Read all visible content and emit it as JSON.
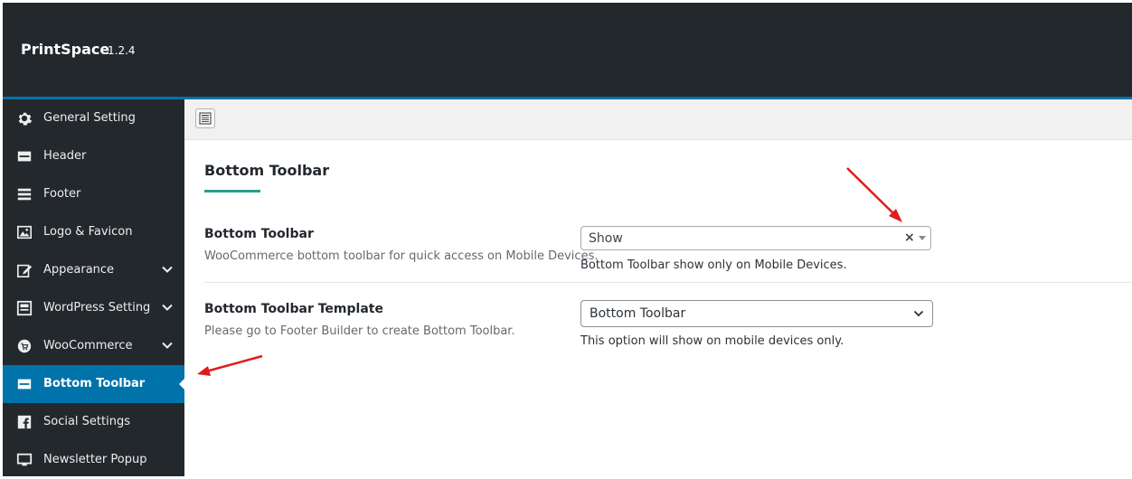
{
  "app": {
    "name": "PrintSpace",
    "version": "1.2.4"
  },
  "sidebar": {
    "items": [
      {
        "label": "General Setting",
        "icon": "gear-icon",
        "has_chevron": false,
        "active": false
      },
      {
        "label": "Header",
        "icon": "header-icon",
        "has_chevron": false,
        "active": false
      },
      {
        "label": "Footer",
        "icon": "menu-lines-icon",
        "has_chevron": false,
        "active": false
      },
      {
        "label": "Logo & Favicon",
        "icon": "image-icon",
        "has_chevron": false,
        "active": false
      },
      {
        "label": "Appearance",
        "icon": "edit-icon",
        "has_chevron": true,
        "active": false
      },
      {
        "label": "WordPress Setting",
        "icon": "layout-icon",
        "has_chevron": true,
        "active": false
      },
      {
        "label": "WooCommerce",
        "icon": "cart-icon",
        "has_chevron": true,
        "active": false
      },
      {
        "label": "Bottom Toolbar",
        "icon": "toolbar-icon",
        "has_chevron": false,
        "active": true
      },
      {
        "label": "Social Settings",
        "icon": "facebook-icon",
        "has_chevron": false,
        "active": false
      },
      {
        "label": "Newsletter Popup",
        "icon": "monitor-icon",
        "has_chevron": false,
        "active": false
      }
    ]
  },
  "toolbar": {
    "icon": "page-layout-icon"
  },
  "main": {
    "section_title": "Bottom Toolbar",
    "settings": [
      {
        "label": "Bottom Toolbar",
        "description": "WooCommerce bottom toolbar for quick access on Mobile Devices.",
        "control_value": "Show",
        "help": "Bottom Toolbar show only on Mobile Devices."
      },
      {
        "label": "Bottom Toolbar Template",
        "description": "Please go to Footer Builder to create Bottom Toolbar.",
        "control_value": "Bottom Toolbar",
        "help": "This option will show on mobile devices only."
      }
    ]
  },
  "colors": {
    "header_bg": "#23282d",
    "sidebar_bg": "#23282d",
    "accent": "#0073aa",
    "title_underline": "#2a9d8f",
    "annotation_arrow": "#e01b1b"
  }
}
